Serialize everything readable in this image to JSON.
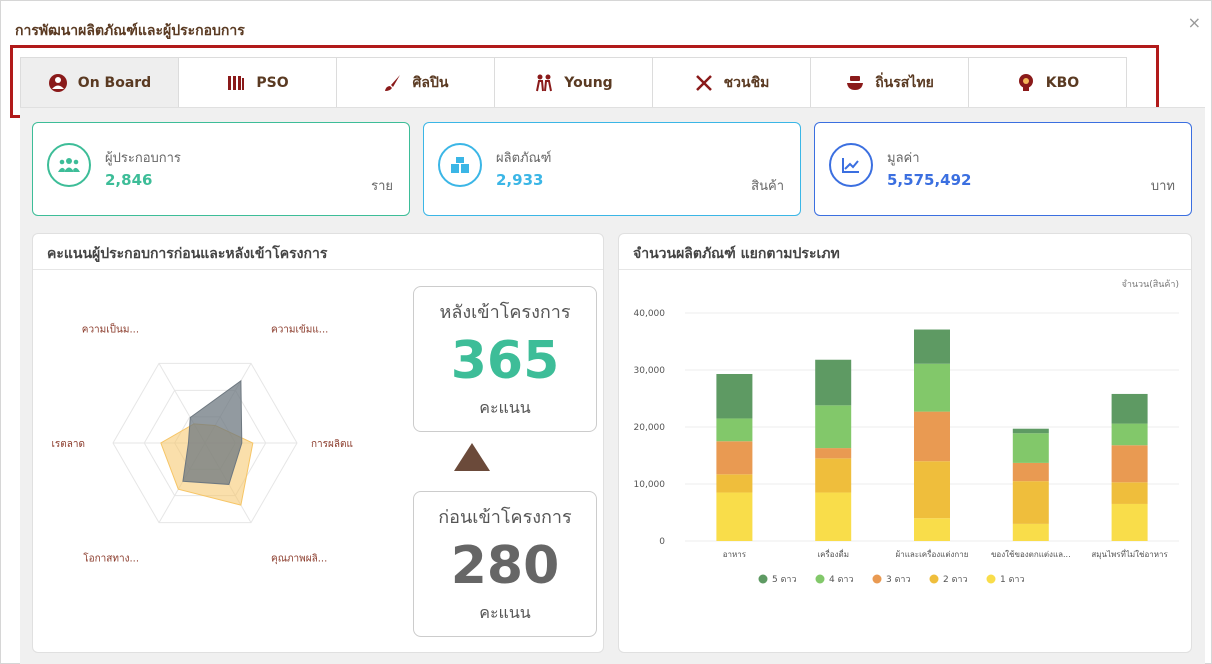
{
  "window": {
    "title": "การพัฒนาผลิตภัณฑ์และผู้ประกอบการ",
    "close": "×"
  },
  "tabs": [
    {
      "label": "On Board",
      "icon": "onboard-icon",
      "active": true
    },
    {
      "label": "PSO",
      "icon": "books-icon",
      "active": false
    },
    {
      "label": "ศิลปิน",
      "icon": "brush-icon",
      "active": false
    },
    {
      "label": "Young",
      "icon": "people-icon",
      "active": false
    },
    {
      "label": "ชวนชิม",
      "icon": "utensils-icon",
      "active": false
    },
    {
      "label": "ถิ่นรสไทย",
      "icon": "food-bowl-icon",
      "active": false
    },
    {
      "label": "KBO",
      "icon": "brain-icon",
      "active": false
    }
  ],
  "stats": [
    {
      "label": "ผู้ประกอบการ",
      "value": "2,846",
      "unit": "ราย",
      "icon": "users-icon",
      "color": "#3dbd98"
    },
    {
      "label": "ผลิตภัณฑ์",
      "value": "2,933",
      "unit": "สินค้า",
      "icon": "boxes-icon",
      "color": "#3bb6e6"
    },
    {
      "label": "มูลค่า",
      "value": "5,575,492",
      "unit": "บาท",
      "icon": "chart-up-icon",
      "color": "#3b6fe0"
    }
  ],
  "radar_panel": {
    "title": "คะแนนผู้ประกอบการก่อนและหลังเข้าโครงการ",
    "axes": [
      "ความเข้มแ...",
      "การผลิตแ",
      "คุณภาพผลิ...",
      "โอกาสทาง...",
      "เรตลาด",
      "ความเป็นม..."
    ],
    "after": {
      "title": "หลังเข้าโครงการ",
      "score": "365",
      "unit": "คะแนน",
      "color": "#3dbd98"
    },
    "before": {
      "title": "ก่อนเข้าโครงการ",
      "score": "280",
      "unit": "คะแนน",
      "color": "#666666"
    }
  },
  "bar_panel": {
    "title": "จำนวนผลิตภัณฑ์ แยกตามประเภท"
  },
  "chart_data": {
    "type": "bar",
    "stacked": true,
    "title": "",
    "ylabel": "จำนวน(สินค้า)",
    "ylim": [
      0,
      40000
    ],
    "yticks": [
      "0",
      "10,000",
      "20,000",
      "30,000",
      "40,000"
    ],
    "categories": [
      "อาหาร",
      "เครื่องดื่ม",
      "ผ้าและเครื่องแต่งกาย",
      "ของใช้ของตกแต่งแล...",
      "สมุนไพรที่ไม่ใช่อาหาร"
    ],
    "legend_position": "bottom",
    "series": [
      {
        "name": "1 ดาว",
        "color": "#f9dd4a",
        "values": [
          8500,
          8500,
          4000,
          3000,
          6500
        ]
      },
      {
        "name": "2 ดาว",
        "color": "#efbe3c",
        "values": [
          3200,
          6000,
          10000,
          7500,
          3800
        ]
      },
      {
        "name": "3 ดาว",
        "color": "#e99a52",
        "values": [
          5800,
          1800,
          8700,
          3200,
          6500
        ]
      },
      {
        "name": "4 ดาว",
        "color": "#82c86a",
        "values": [
          4000,
          7500,
          8400,
          5200,
          3800
        ]
      },
      {
        "name": "5 ดาว",
        "color": "#5e9a63",
        "values": [
          7800,
          8000,
          6000,
          800,
          5200
        ]
      }
    ]
  },
  "radar_data": {
    "max": 100,
    "after": [
      78,
      40,
      52,
      48,
      18,
      32
    ],
    "before": [
      22,
      52,
      78,
      58,
      48,
      24
    ]
  }
}
